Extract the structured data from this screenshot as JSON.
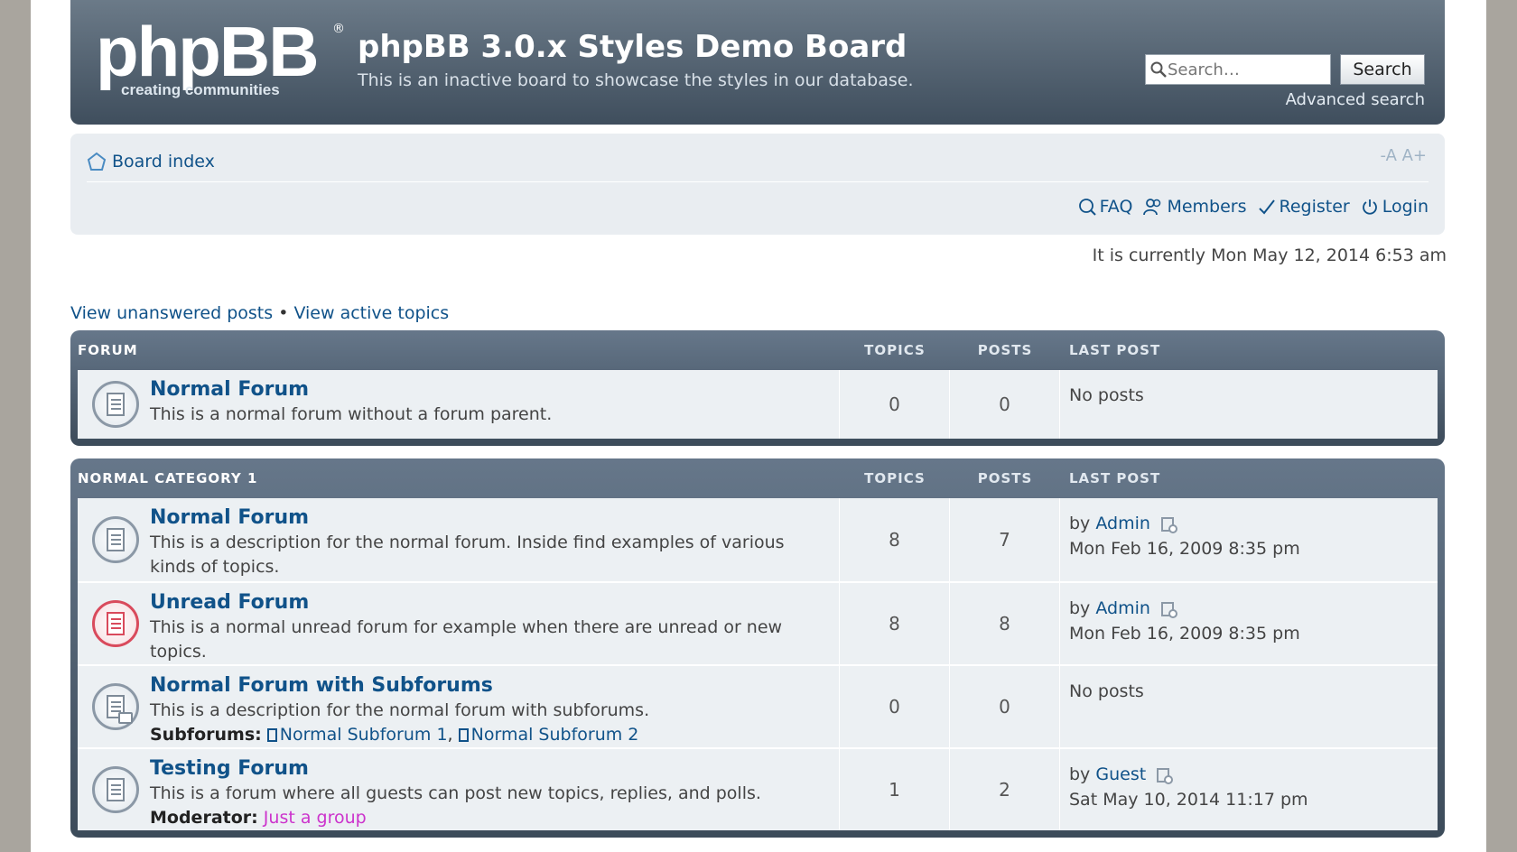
{
  "header": {
    "logo_text": "phpBB",
    "logo_registered": "®",
    "logo_tagline": "creating communities",
    "title": "phpBB 3.0.x Styles Demo Board",
    "description": "This is an inactive board to showcase the styles in our database.",
    "search_placeholder": "Search…",
    "search_button": "Search",
    "advanced_search": "Advanced search"
  },
  "navbar": {
    "breadcrumb": "Board index",
    "font_size_control": "-A A+",
    "links": [
      {
        "label": "FAQ",
        "icon": "faq-icon"
      },
      {
        "label": "Members",
        "icon": "members-icon"
      },
      {
        "label": "Register",
        "icon": "register-icon"
      },
      {
        "label": "Login",
        "icon": "power-icon"
      }
    ]
  },
  "datetime": "It is currently Mon May 12, 2014 6:53 am",
  "quicklinks": {
    "unanswered": "View unanswered posts",
    "separator": "•",
    "active": "View active topics"
  },
  "categories": [
    {
      "name": "FORUM",
      "col_topics": "TOPICS",
      "col_posts": "POSTS",
      "col_last": "LAST POST",
      "forums": [
        {
          "title": "Normal Forum",
          "description": "This is a normal forum without a forum parent.",
          "topics": "0",
          "posts": "0",
          "last_post": "No posts"
        }
      ]
    },
    {
      "name": "NORMAL CATEGORY 1",
      "col_topics": "TOPICS",
      "col_posts": "POSTS",
      "col_last": "LAST POST",
      "forums": [
        {
          "title": "Normal Forum",
          "description": "This is a description for the normal forum. Inside find examples of various kinds of topics.",
          "topics": "8",
          "posts": "7",
          "last_by": "by",
          "last_author": "Admin",
          "last_date": "Mon Feb 16, 2009 8:35 pm"
        },
        {
          "title": "Unread Forum",
          "description": "This is a normal unread forum for example when there are unread or new topics.",
          "topics": "8",
          "posts": "8",
          "last_by": "by",
          "last_author": "Admin",
          "last_date": "Mon Feb 16, 2009 8:35 pm"
        },
        {
          "title": "Normal Forum with Subforums",
          "description": "This is a description for the normal forum with subforums.",
          "subforums_label": "Subforums:",
          "subforum1": "Normal Subforum 1",
          "subforum_sep": ",",
          "subforum2": "Normal Subforum 2",
          "topics": "0",
          "posts": "0",
          "last_post": "No posts"
        },
        {
          "title": "Testing Forum",
          "description": "This is a forum where all guests can post new topics, replies, and polls.",
          "moderator_label": "Moderator:",
          "moderator": "Just a group",
          "topics": "1",
          "posts": "2",
          "last_by": "by",
          "last_author": "Guest",
          "last_date": "Sat May 10, 2014 11:17 pm"
        }
      ]
    }
  ],
  "colors": {
    "header_top": "#6b7a88",
    "header_bottom": "#3f4e5d",
    "link": "#105289",
    "unread": "#d94a5c",
    "group": "#cc33cc"
  }
}
